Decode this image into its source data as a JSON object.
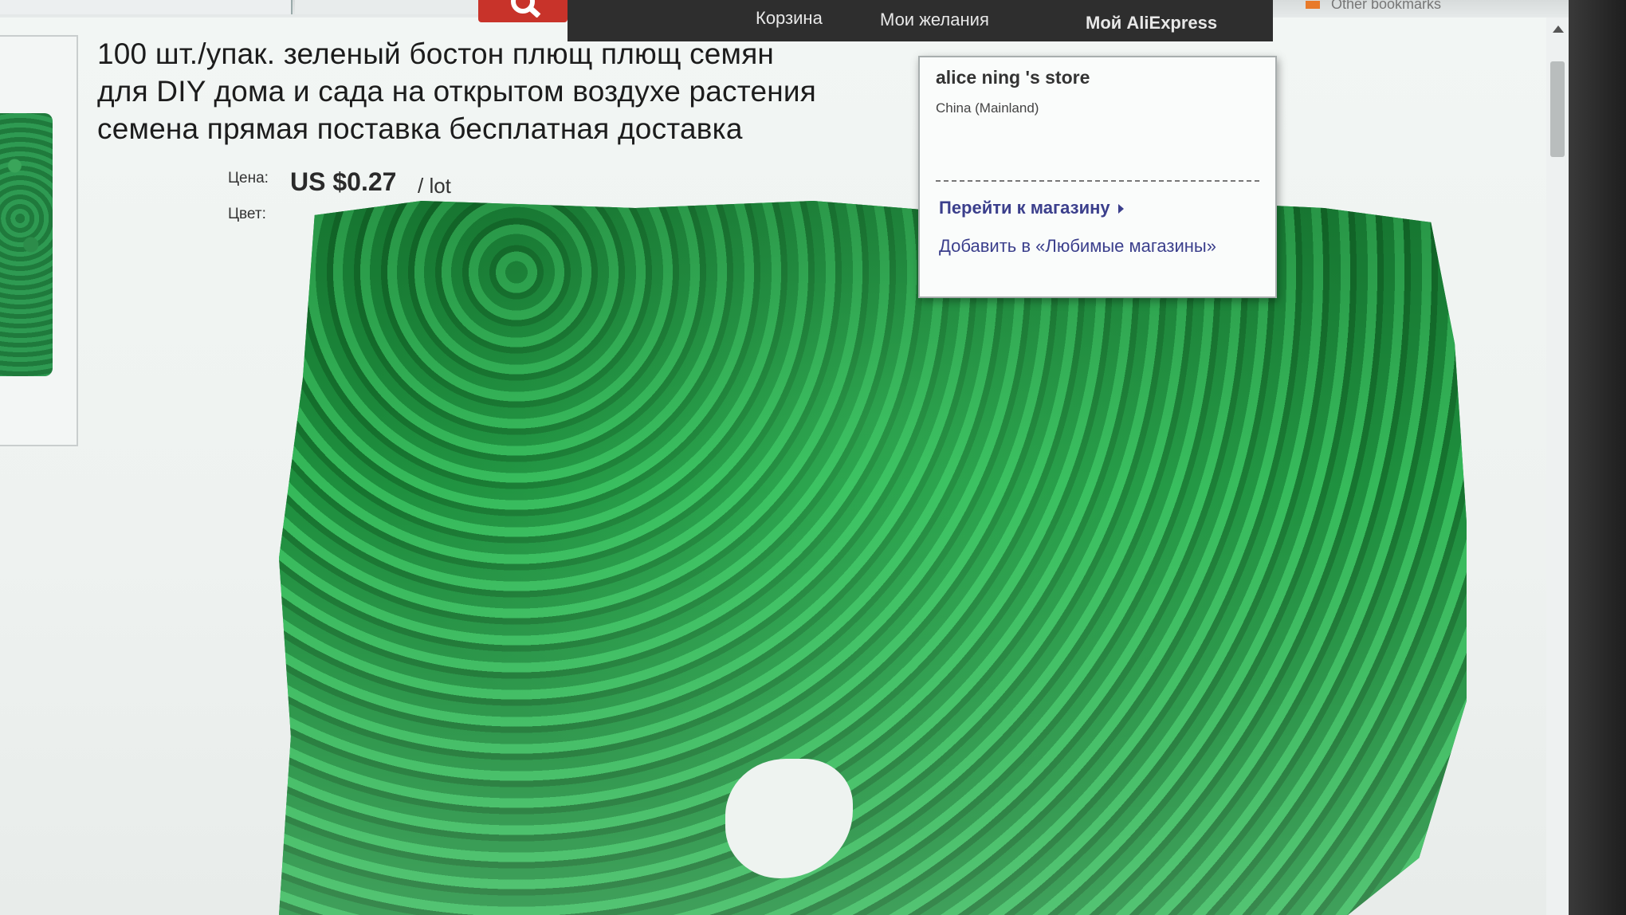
{
  "nav": {
    "cart": "Корзина",
    "wishlist": "Мои желания",
    "my_aliexpress": "Мой AliExpress"
  },
  "bookmarks": {
    "label": "Other bookmarks"
  },
  "product": {
    "title_line1": "100 шт./упак. зеленый бостон плющ плющ семян",
    "title_line2": "для DIY дома и сада на открытом воздухе растения",
    "title_line3": "семена прямая поставка бесплатная доставка",
    "price_label": "Цена:",
    "price_value": "US $0.27",
    "price_unit": "/ lot",
    "color_label": "Цвет:"
  },
  "store_popup": {
    "store_name": "alice ning 's store",
    "country": "China (Mainland)",
    "goto_store": "Перейти к магазину",
    "add_favorite": "Добавить в «Любимые магазины»"
  },
  "colors": {
    "nav_bg": "#2e2e2e",
    "search_button": "#c8332a",
    "link": "#3b3f8c",
    "ivy_green": "#2aa24a"
  }
}
